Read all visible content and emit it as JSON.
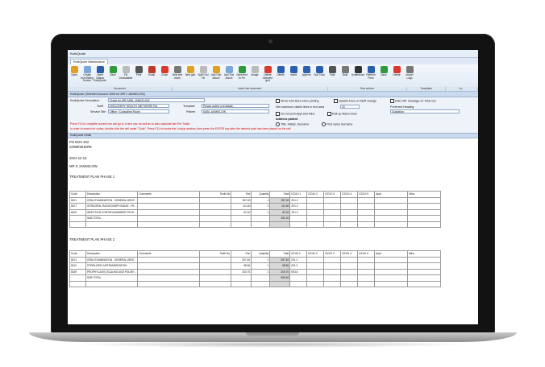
{
  "window": {
    "title": "KwikQuote",
    "tab": "KwikQuote Maintenance"
  },
  "ribbon": {
    "buttons": [
      {
        "label": "Open",
        "icon": "folder-open-icon",
        "color": "#e0a020"
      },
      {
        "label": "Create from Billing Screen",
        "icon": "create-icon",
        "color": "#7aa7d8"
      },
      {
        "label": "Open Classic KwikQuote",
        "icon": "classic-icon",
        "color": "#2a5fb0"
      },
      {
        "label": "Save",
        "icon": "save-icon",
        "color": "#2f9a3c"
      },
      {
        "label": "Fill Unavailable",
        "icon": "fill-icon",
        "color": "#bbbbbb"
      },
      {
        "label": "Print",
        "icon": "print-icon",
        "color": "#555555"
      },
      {
        "label": "Email",
        "icon": "email-icon",
        "color": "#c0392b"
      },
      {
        "label": "Close",
        "icon": "close-icon",
        "color": "#d93a2b"
      },
      {
        "label": "New text block",
        "icon": "text-block-icon",
        "color": "#777777"
      },
      {
        "label": "New grid",
        "icon": "grid-icon",
        "color": "#e0a020"
      },
      {
        "label": "Split Grid Fix",
        "icon": "split-icon",
        "color": "#bbbbbb"
      },
      {
        "label": "Add Grid Above",
        "icon": "grid-above-icon",
        "color": "#e0a020"
      },
      {
        "label": "Add Text Above",
        "icon": "text-above-icon",
        "color": "#7aa7d8"
      },
      {
        "label": "Save text to Fix",
        "icon": "save-text-icon",
        "color": "#2f9a3c"
      },
      {
        "label": "Image",
        "icon": "image-icon",
        "color": "#bbbbbb"
      },
      {
        "label": "Delete selected grid",
        "icon": "delete-grid-icon",
        "color": "#d93a2b"
      },
      {
        "label": "Delete",
        "icon": "delete-icon",
        "color": "#2a5fb0"
      },
      {
        "label": "Insert",
        "icon": "insert-icon",
        "color": "#2a5fb0"
      },
      {
        "label": "Append",
        "icon": "append-icon",
        "color": "#2a5fb0"
      },
      {
        "label": "Sub Total",
        "icon": "subtotal-icon",
        "color": "#2a5fb0"
      },
      {
        "label": "Total",
        "icon": "total-icon",
        "color": "#555555"
      },
      {
        "label": "Bold",
        "icon": "bold-icon",
        "color": "#777777"
      },
      {
        "label": "Underscore",
        "icon": "underscore-icon",
        "color": "#333333"
      },
      {
        "label": "Refresh Fees",
        "icon": "refresh-icon",
        "color": "#2a5fb0"
      },
      {
        "label": "Save",
        "icon": "save2-icon",
        "color": "#2f9a3c"
      },
      {
        "label": "Delete",
        "icon": "delete2-icon",
        "color": "#d93a2b"
      },
      {
        "label": "Import Logo",
        "icon": "import-icon",
        "color": "#777777"
      }
    ],
    "groups": [
      "Document",
      "Insert into document",
      "Row actions",
      "Templates",
      "Lo..."
    ]
  },
  "header": {
    "account": "KwikQuote (Selected Account 4006 for MR J JANKELOW)",
    "details": "KwikQuote Detail"
  },
  "form": {
    "description_label": "KwikQuote Description",
    "description_value": "Quote for MR SABL JANKELOW",
    "tariff_label": "Tariff",
    "tariff_value": "DISCOVERY HEALTH (NETWORK RA",
    "service_label": "Service Site",
    "service_value": "Office / Consulting Room",
    "template_label": "Template",
    "template_value": "Please select a template...",
    "patient_label": "Patient",
    "patient_value": "SABL JANKELOW",
    "opt_gridlines": "Show Grid lines when printing",
    "opt_update_fees": "Update Fees on Tariff change",
    "opt_hide_vat": "Hide VAT message on Total row",
    "max_lines_label": "Set maximum visible lines in text area",
    "max_lines_value": "20",
    "opt_no_appt": "Do not print Appt and Mins",
    "opt_rollup": "Roll-up Macro lines",
    "heading_label": "Preferred Heading",
    "heading_value": "Quotation",
    "address_label": "Address patient",
    "addr_opt1": "Title, Initials, Surname",
    "addr_opt2": "First name Surname",
    "msg1": "Press F10 to complete current row and go to a new row, as well as to auto-calculate tab-Fee Totals",
    "msg2": "In order to search for codes, double-click the cell under \"Code\". Press F11 to invoke the Lookup window, then press the ENTER key after the desired code has been placed on the cell"
  },
  "doc": {
    "address1": "PO BOX 202",
    "address2": "SOMEWHERE",
    "date": "2021-12-10",
    "patient": "MR S JANKELOW",
    "phase1": "TREATMENT PLAN PHASE 1",
    "phase2": "TREATMENT PLAN PHASE 2",
    "columns": [
      "Code",
      "Description",
      "Comments",
      "Tooth No",
      "Fee",
      "Quantity",
      "Total",
      "ICD10 1",
      "ICD10 2",
      "ICD10 3",
      "ICD10 4",
      "ICD10 5",
      "Appt",
      "Mins"
    ],
    "rows1": [
      [
        "8101",
        "ORAL EXAMINATION - GENERAL DENT...",
        "",
        "",
        "257.40",
        "1",
        "257.40",
        "Z01.2",
        "",
        "",
        "",
        "",
        "",
        ""
      ],
      [
        "8107",
        "INTRAORAL RADIOGRAPH IMAGE - PE...",
        "",
        "",
        "111.60",
        "1",
        "111.60",
        "Z01.2",
        "",
        "",
        "",
        "",
        "",
        ""
      ],
      [
        "8109",
        "INFECTION CONTROL/BARRIER TECH...",
        "",
        "",
        "82.00",
        "1",
        "82.00",
        "Z01.2",
        "",
        "",
        "",
        "",
        "",
        ""
      ],
      [
        "",
        "SUB TOTAL",
        "",
        "",
        "",
        "",
        "451.00",
        "",
        "",
        "",
        "",
        "",
        "",
        ""
      ]
    ],
    "rows2": [
      [
        "8101",
        "ORAL EXAMINATION - GENERAL DENT...",
        "",
        "",
        "257.40",
        "1",
        "257.40",
        "Z01.2",
        "",
        "",
        "",
        "",
        "",
        ""
      ],
      [
        "8110",
        "STERILIZED INSTRUMENTATION",
        "",
        "",
        "98.50",
        "1",
        "98.50",
        "Z01.2",
        "",
        "",
        "",
        "",
        "",
        ""
      ],
      [
        "8159",
        "PROPHYLAXIS (SCALING AND POLISH...",
        "",
        "",
        "200.70",
        "1",
        "200.70",
        "K03.6",
        "",
        "",
        "",
        "",
        "",
        ""
      ],
      [
        "",
        "SUB TOTAL",
        "",
        "",
        "",
        "",
        "556.60",
        "",
        "",
        "",
        "",
        "",
        "",
        ""
      ]
    ]
  }
}
